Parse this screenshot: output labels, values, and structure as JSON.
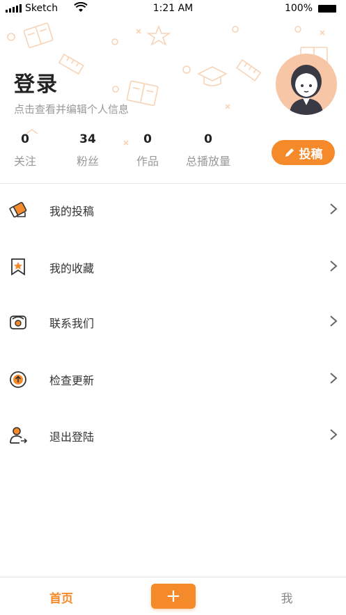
{
  "status_bar": {
    "carrier": "Sketch",
    "time": "1:21 AM",
    "battery": "100%"
  },
  "profile": {
    "title": "登录",
    "subtitle": "点击查看并编辑个人信息"
  },
  "stats": [
    {
      "value": "0",
      "label": "关注"
    },
    {
      "value": "34",
      "label": "粉丝"
    },
    {
      "value": "0",
      "label": "作品"
    },
    {
      "value": "0",
      "label": "总播放量"
    }
  ],
  "submit_button": {
    "label": "投稿",
    "icon": "pencil-icon"
  },
  "menu": [
    {
      "label": "我的投稿",
      "icon": "submission-icon"
    },
    {
      "label": "我的收藏",
      "icon": "bookmark-star-icon"
    },
    {
      "label": "联系我们",
      "icon": "telephone-icon"
    },
    {
      "label": "检查更新",
      "icon": "upload-circle-icon"
    },
    {
      "label": "退出登陆",
      "icon": "user-logout-icon"
    }
  ],
  "tabbar": {
    "home": "首页",
    "add": "+",
    "me": "我"
  },
  "colors": {
    "accent": "#f58a2b",
    "dark": "#333333",
    "muted": "#999999"
  }
}
